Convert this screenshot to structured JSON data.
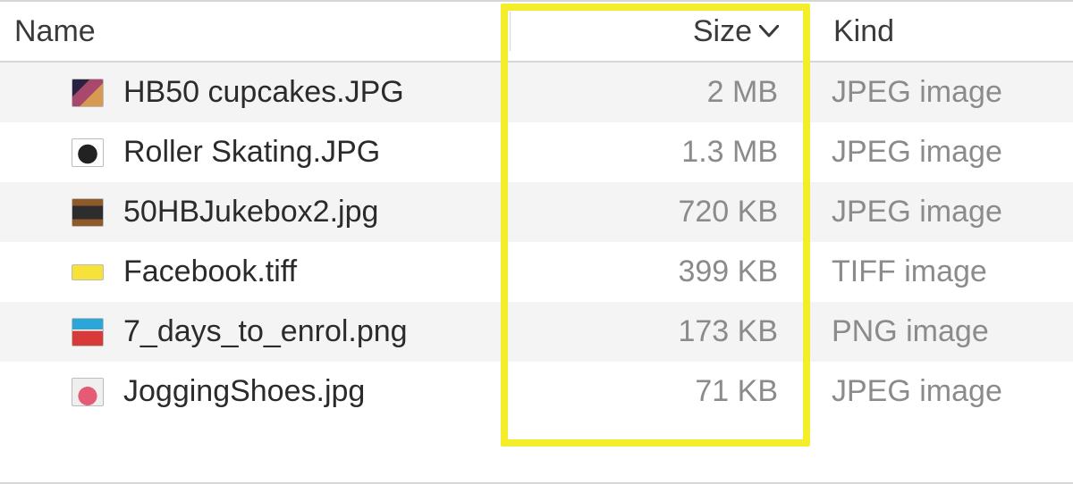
{
  "columns": {
    "name": "Name",
    "size": "Size",
    "kind": "Kind"
  },
  "sort": {
    "column": "size",
    "direction": "desc"
  },
  "files": [
    {
      "name": "HB50 cupcakes.JPG",
      "size": "2 MB",
      "kind": "JPEG image",
      "thumb": "cupcakes"
    },
    {
      "name": "Roller Skating.JPG",
      "size": "1.3 MB",
      "kind": "JPEG image",
      "thumb": "roller"
    },
    {
      "name": "50HBJukebox2.jpg",
      "size": "720 KB",
      "kind": "JPEG image",
      "thumb": "jukebox"
    },
    {
      "name": "Facebook.tiff",
      "size": "399 KB",
      "kind": "TIFF image",
      "thumb": "facebook"
    },
    {
      "name": "7_days_to_enrol.png",
      "size": "173 KB",
      "kind": "PNG image",
      "thumb": "sevendays"
    },
    {
      "name": "JoggingShoes.jpg",
      "size": "71 KB",
      "kind": "JPEG image",
      "thumb": "jogging"
    }
  ]
}
